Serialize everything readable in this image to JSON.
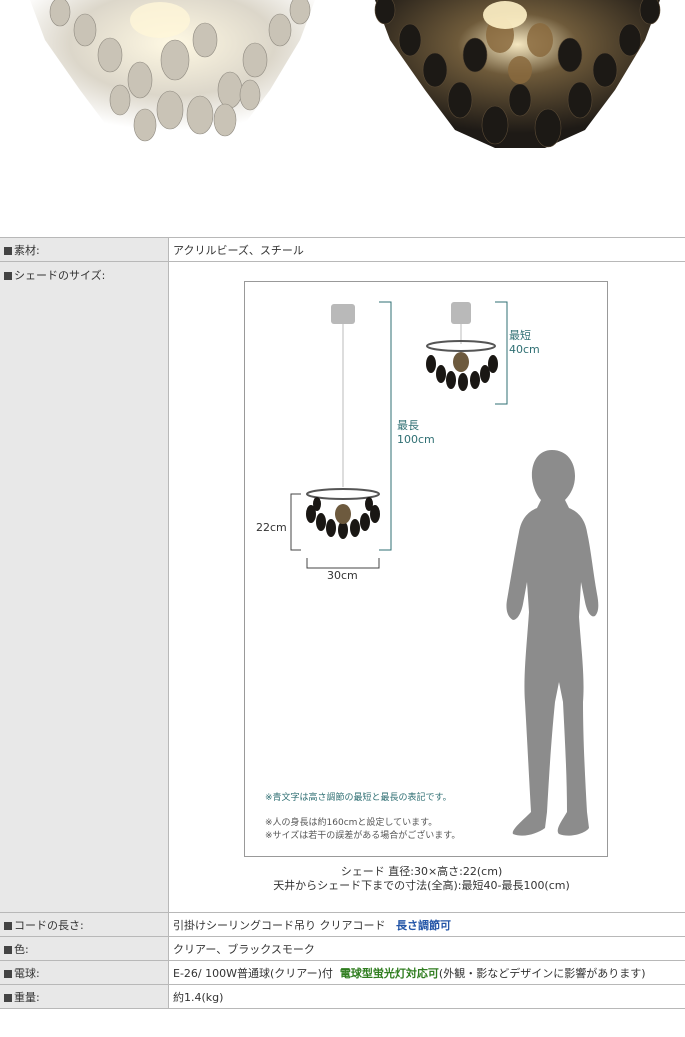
{
  "specs": {
    "material": {
      "label": "素材:",
      "value": "アクリルビーズ、スチール"
    },
    "shade_size": {
      "label": "シェードのサイズ:",
      "diagram": {
        "shortest_label": "最短",
        "shortest_value": "40cm",
        "longest_label": "最長",
        "longest_value": "100cm",
        "height": "22cm",
        "width": "30cm",
        "note1": "※青文字は高さ調節の最短と最長の表記です。",
        "note2": "※人の身長は約160cmと設定しています。",
        "note3": "※サイズは若干の誤差がある場合がございます。"
      },
      "caption_line1": "シェード 直径:30×高さ:22(cm)",
      "caption_line2": "天井からシェード下までの寸法(全高):最短40-最長100(cm)"
    },
    "cord": {
      "label": "コードの長さ:",
      "value": "引掛けシーリングコード吊り クリアコード",
      "highlight": "長さ調節可"
    },
    "color": {
      "label": "色:",
      "value": "クリアー、ブラックスモーク"
    },
    "bulb": {
      "label": "電球:",
      "value": "E-26/ 100W普通球(クリアー)付",
      "highlight": "電球型蛍光灯対応可",
      "tail": "(外観・影などデザインに影響があります)"
    },
    "weight": {
      "label": "重量:",
      "value": "約1.4(kg)"
    }
  },
  "colors": {
    "accent_blue": "#2355a7",
    "accent_green": "#2f7d1f",
    "dimension_teal": "#2f6f73"
  }
}
